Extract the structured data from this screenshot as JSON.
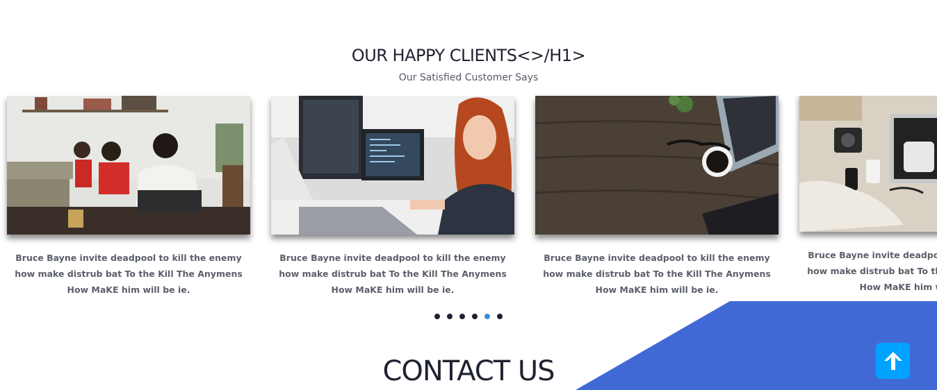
{
  "clients": {
    "title": "OUR HAPPY CLIENTS<>/H1>",
    "subtitle": "Our Satisfied Customer Says",
    "cards": [
      {
        "lines": [
          "Bruce Bayne invite deadpool to kill the enemy",
          "how make distrub bat To the Kill The Anymens",
          "How MaKE him will be ie."
        ]
      },
      {
        "lines": [
          "Bruce Bayne invite deadpool to kill the enemy",
          "how make distrub bat To the Kill The Anymens",
          "How MaKE him will be ie."
        ]
      },
      {
        "lines": [
          "Bruce Bayne invite deadpool to kill the enemy",
          "how make distrub bat To the Kill The Anymens",
          "How MaKE him will be ie."
        ]
      },
      {
        "lines": [
          "Bruce Bayne invite deadpool to kill the enemy",
          "how make distrub bat To the Kill The Anymens",
          "How MaKE him will be ie."
        ]
      }
    ],
    "pagination": {
      "count": 6,
      "active_index": 4
    }
  },
  "contact": {
    "title": "CONTACT US"
  },
  "colors": {
    "accent_blue": "#4169d6",
    "scroll_button": "#00a2ff",
    "active_dot": "#3d8fd6",
    "heading": "#1f2230"
  },
  "icons": {
    "scroll_top": "arrow-up-icon"
  }
}
